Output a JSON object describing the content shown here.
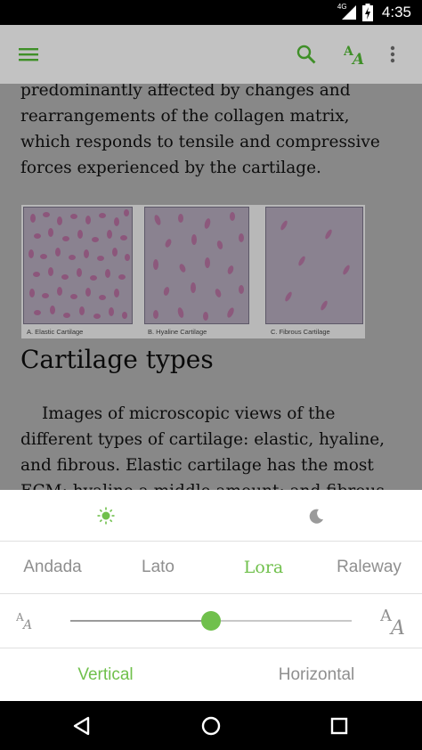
{
  "status_bar": {
    "time": "4:35",
    "network_label": "4G",
    "battery_level": 0.9
  },
  "toolbar": {
    "menu_icon": "hamburger-menu-icon",
    "search_icon": "search-icon",
    "font_settings_icon": "text-size-icon",
    "overflow_icon": "more-vertical-icon",
    "accent_color": "#3f8f28"
  },
  "content": {
    "paragraph_1": "predominantly affected by changes and rearrangements of the collagen matrix, which responds to tensile and compressive forces experienced by the cartilage.",
    "figure": {
      "captions": [
        "A.   Elastic Cartilage",
        "B.  Hyaline Cartilage",
        "C. Fibrous Cartilage"
      ]
    },
    "heading": "Cartilage types",
    "paragraph_2": "Images of microscopic views of the different types of cartilage: elastic, hyaline, and fibrous. Elastic cartilage has the most ECM; hyaline a middle amount; and fibrous cartilage has the"
  },
  "settings": {
    "theme": {
      "day_icon": "sun-icon",
      "night_icon": "moon-icon",
      "selected": "day"
    },
    "fonts": [
      {
        "label": "Andada",
        "selected": false
      },
      {
        "label": "Lato",
        "selected": false
      },
      {
        "label": "Lora",
        "selected": true
      },
      {
        "label": "Raleway",
        "selected": false
      }
    ],
    "font_size": {
      "decrease_icon": "small-text-size-icon",
      "increase_icon": "large-text-size-icon",
      "level": 0.5
    },
    "orientation": {
      "options": [
        {
          "label": "Vertical",
          "selected": true
        },
        {
          "label": "Horizontal",
          "selected": false
        }
      ]
    },
    "accent_color": "#70c04c"
  },
  "nav_bar": {
    "back_icon": "back-triangle-icon",
    "home_icon": "home-circle-icon",
    "recents_icon": "recents-square-icon"
  }
}
